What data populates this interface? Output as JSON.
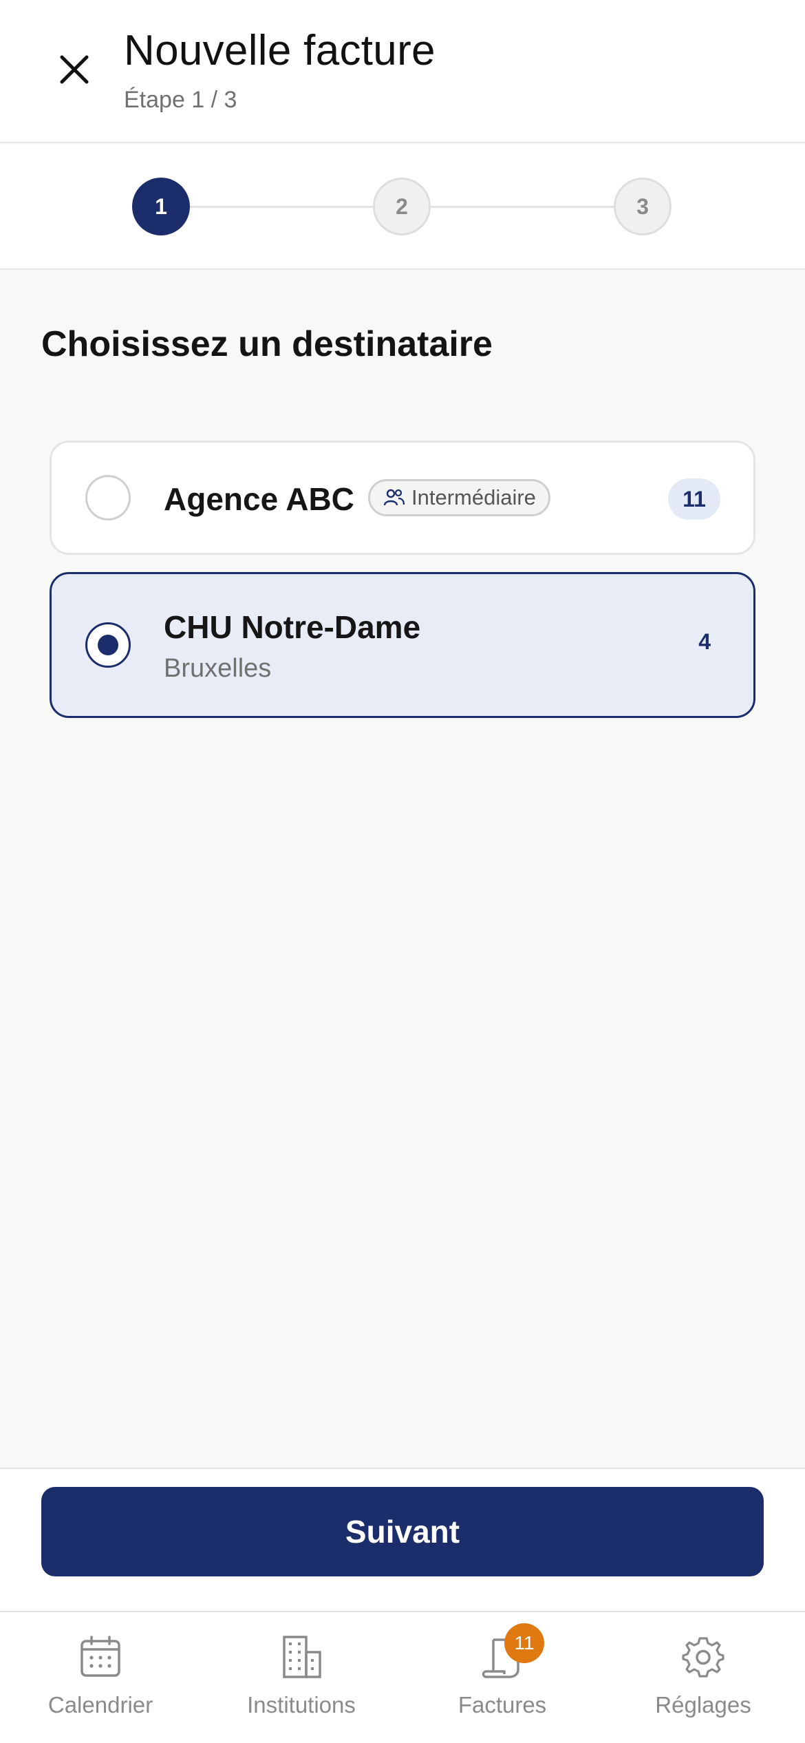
{
  "header": {
    "title": "Nouvelle facture",
    "subtitle": "Étape 1 / 3"
  },
  "stepper": {
    "steps": [
      {
        "label": "1",
        "state": "active"
      },
      {
        "label": "2",
        "state": "inactive"
      },
      {
        "label": "3",
        "state": "inactive"
      }
    ]
  },
  "main": {
    "section_title": "Choisissez un destinataire",
    "recipients": [
      {
        "name": "Agence ABC",
        "tag": "Intermédiaire",
        "count": "11",
        "selected": false
      },
      {
        "name": "CHU Notre-Dame",
        "city": "Bruxelles",
        "count": "4",
        "selected": true
      }
    ]
  },
  "footer": {
    "next_label": "Suivant"
  },
  "bottom_nav": {
    "items": [
      {
        "label": "Calendrier",
        "icon": "calendar-icon"
      },
      {
        "label": "Institutions",
        "icon": "building-icon"
      },
      {
        "label": "Factures",
        "icon": "invoice-icon",
        "badge": "11"
      },
      {
        "label": "Réglages",
        "icon": "gear-icon"
      }
    ]
  },
  "colors": {
    "primary": "#1b2d6b",
    "selected_bg": "#e8ecf7",
    "badge_orange": "#e07a10",
    "background": "#f8f8f6"
  }
}
